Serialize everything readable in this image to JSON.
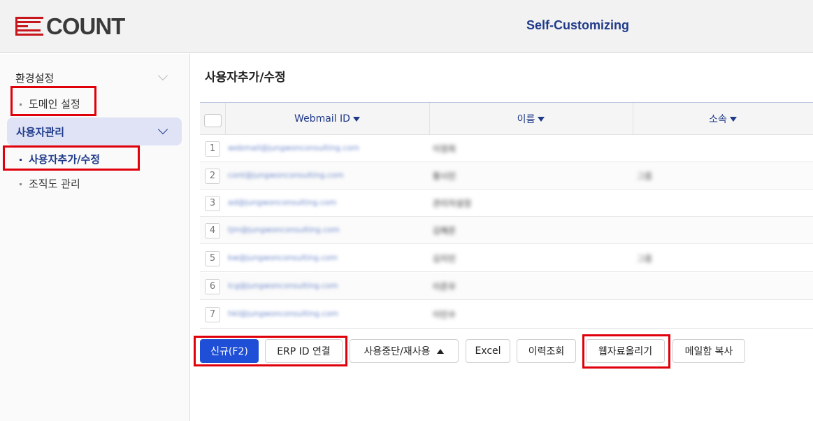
{
  "header": {
    "logo_text": "COUNT",
    "title": "Self-Customizing",
    "brand_color": "#c8161d"
  },
  "sidebar": {
    "group_settings": "환경설정",
    "domain_settings": "도메인 설정",
    "group_users": "사용자관리",
    "user_add_edit": "사용자추가/수정",
    "org_chart": "조직도 관리"
  },
  "main": {
    "title": "사용자추가/수정",
    "columns": [
      "Webmail ID",
      "이름",
      "소속"
    ],
    "rows": [
      {
        "num": "1",
        "email": "webmail@jungwonconsulting.com",
        "name": "이정희",
        "dept": ""
      },
      {
        "num": "2",
        "email": "cont@jungwonconsulting.com",
        "name": "황시민",
        "dept": "그룹"
      },
      {
        "num": "3",
        "email": "ad@jungwonconsulting.com",
        "name": "관리자설정",
        "dept": ""
      },
      {
        "num": "4",
        "email": "tjm@jungwonconsulting.com",
        "name": "김혜준",
        "dept": ""
      },
      {
        "num": "5",
        "email": "kw@jungwonconsulting.com",
        "name": "김지민",
        "dept": "그룹"
      },
      {
        "num": "6",
        "email": "lcg@jungwonconsulting.com",
        "name": "이준우",
        "dept": ""
      },
      {
        "num": "7",
        "email": "hkl@jungwonconsulting.com",
        "name": "이민수",
        "dept": ""
      }
    ]
  },
  "buttons": {
    "new": "신규(F2)",
    "erp_link": "ERP ID 연결",
    "suspend": "사용중단/재사용",
    "excel": "Excel",
    "history": "이력조회",
    "upload": "웹자료올리기",
    "copy_mailbox": "메일함 복사"
  }
}
